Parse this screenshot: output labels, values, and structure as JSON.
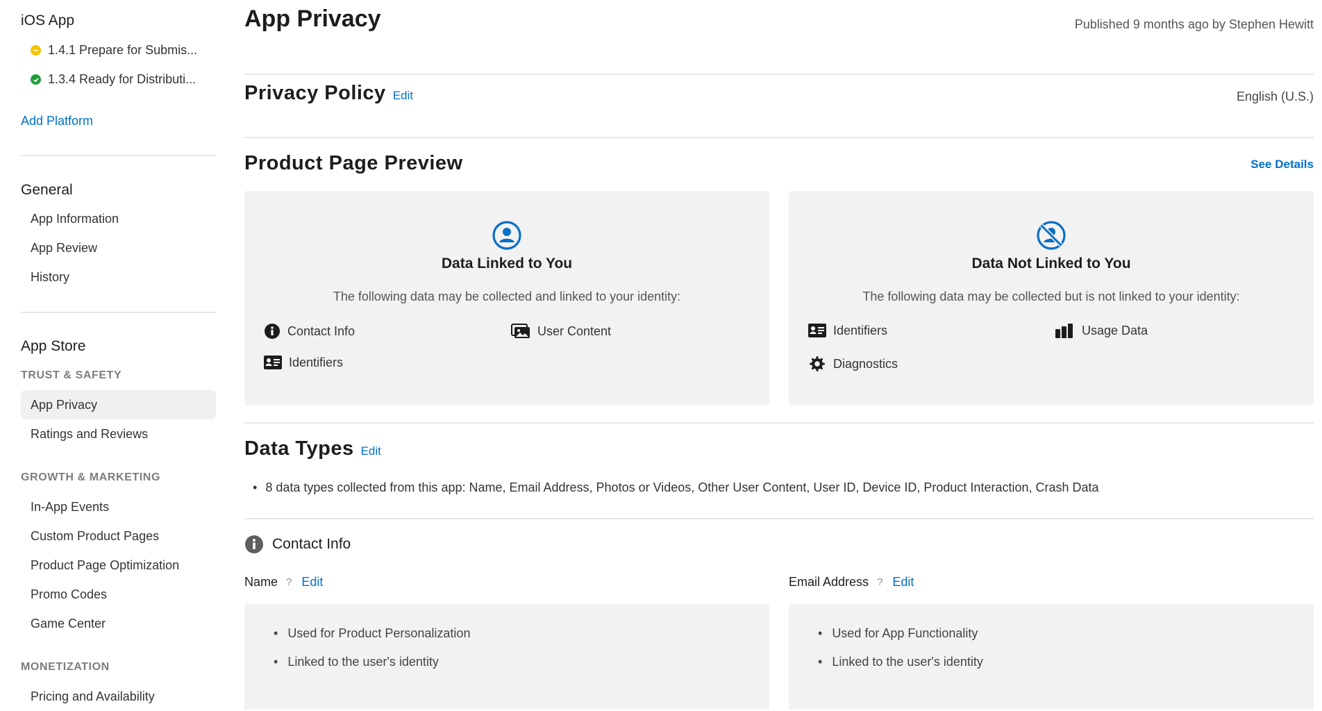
{
  "sidebar": {
    "platform_title": "iOS App",
    "versions": [
      {
        "label": "1.4.1 Prepare for Submis...",
        "status_color": "#f5c400"
      },
      {
        "label": "1.3.4 Ready for Distributi...",
        "status_color": "#1f9d3a"
      }
    ],
    "add_platform": "Add Platform",
    "general": {
      "heading": "General",
      "items": [
        "App Information",
        "App Review",
        "History"
      ]
    },
    "app_store": {
      "heading": "App Store",
      "trust_safety": {
        "label": "TRUST & SAFETY",
        "items": [
          "App Privacy",
          "Ratings and Reviews"
        ]
      },
      "growth": {
        "label": "GROWTH & MARKETING",
        "items": [
          "In-App Events",
          "Custom Product Pages",
          "Product Page Optimization",
          "Promo Codes",
          "Game Center"
        ]
      },
      "monetization": {
        "label": "MONETIZATION",
        "items": [
          "Pricing and Availability"
        ]
      }
    }
  },
  "main": {
    "title": "App Privacy",
    "published": "Published 9 months ago by Stephen Hewitt",
    "privacy_policy": {
      "heading": "Privacy Policy",
      "edit": "Edit",
      "language": "English (U.S.)"
    },
    "preview": {
      "heading": "Product Page Preview",
      "see_details": "See Details",
      "linked": {
        "title": "Data Linked to You",
        "desc": "The following data may be collected and linked to your identity:",
        "items": [
          "Contact Info",
          "User Content",
          "Identifiers"
        ]
      },
      "not_linked": {
        "title": "Data Not Linked to You",
        "desc": "The following data may be collected but is not linked to your identity:",
        "items": [
          "Identifiers",
          "Usage Data",
          "Diagnostics"
        ]
      }
    },
    "data_types": {
      "heading": "Data Types",
      "edit": "Edit",
      "summary": "8 data types collected from this app: Name, Email Address, Photos or Videos, Other User Content, User ID, Device ID, Product Interaction, Crash Data"
    },
    "contact_info": {
      "heading": "Contact Info",
      "fields": [
        {
          "label": "Name",
          "help": "?",
          "edit": "Edit",
          "usages": [
            "Used for Product Personalization",
            "Linked to the user's identity"
          ]
        },
        {
          "label": "Email Address",
          "help": "?",
          "edit": "Edit",
          "usages": [
            "Used for App Functionality",
            "Linked to the user's identity"
          ]
        }
      ]
    }
  },
  "colors": {
    "accent": "#0070c9",
    "card_bg": "#f2f2f2",
    "active_item_bg": "#f0f0f0"
  },
  "icons": [
    "person-circle-icon",
    "person-slash-icon",
    "info-circle-icon",
    "photos-icon",
    "id-card-icon",
    "bar-chart-icon",
    "gear-icon"
  ]
}
